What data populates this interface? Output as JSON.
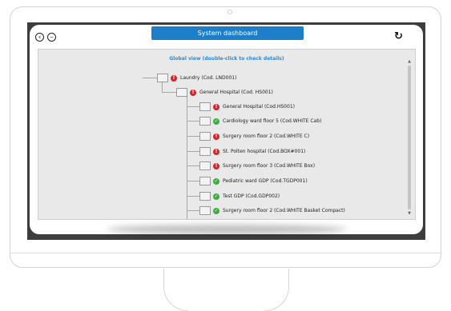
{
  "header": {
    "title": "System dashboard"
  },
  "toolbar": {
    "back_icon": "back-icon",
    "minus_icon": "minus-icon",
    "refresh_icon": "refresh-icon"
  },
  "view": {
    "title": "Global view (double-click to check details)",
    "nodes": [
      {
        "label": "Laundry (Cod. LND001)",
        "status": "error",
        "level": 0
      },
      {
        "label": "General Hospital (Cod. HS001)",
        "status": "error",
        "level": 1
      },
      {
        "label": "General Hospital (Cod.HS001)",
        "status": "error",
        "level": 2
      },
      {
        "label": "Cardiology ward floor 5 (Cod.WHITE Cab)",
        "status": "ok",
        "level": 2
      },
      {
        "label": "Surgery room floor 2 (Cod.WHITE C)",
        "status": "error",
        "level": 2
      },
      {
        "label": "St. Polten hospital (Cod.BOX#001)",
        "status": "error",
        "level": 2
      },
      {
        "label": "Surgery room floor 3 (Cod.WHITE Box)",
        "status": "error",
        "level": 2
      },
      {
        "label": "Pediatric ward GDP (Cod.TGDP001)",
        "status": "ok",
        "level": 2
      },
      {
        "label": "Test GDP (Cod.GDP002)",
        "status": "ok",
        "level": 2
      },
      {
        "label": "Surgery room floor 2 (Cod.WHITE Basket Compact)",
        "status": "ok",
        "level": 2
      }
    ]
  },
  "colors": {
    "accent": "#1d7fc9",
    "error": "#d6242a",
    "ok": "#3bae3d",
    "screen_bg": "#3d3d3d"
  }
}
